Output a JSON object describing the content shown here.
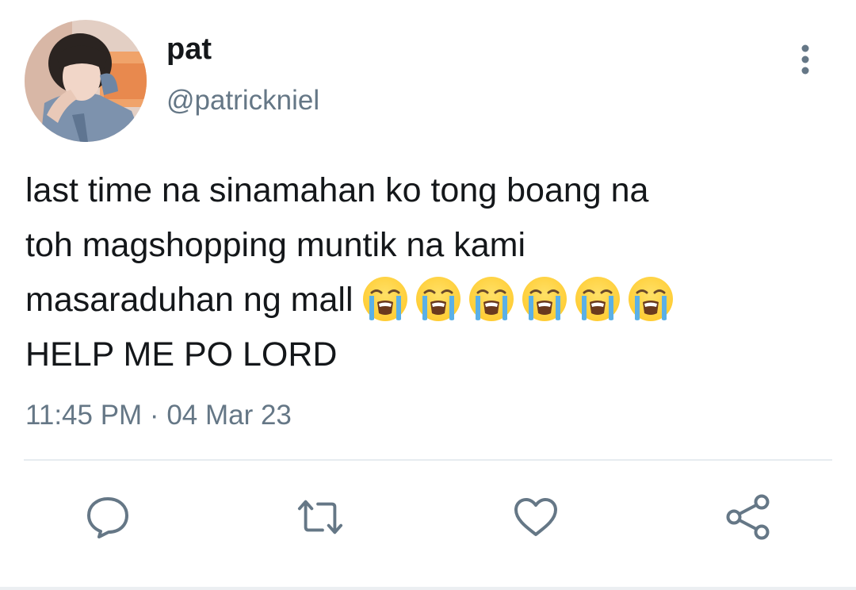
{
  "user": {
    "display_name": "pat",
    "handle": "@patrickniel"
  },
  "tweet": {
    "lines": [
      "last time na sinamahan ko tong boang na",
      "toh magshopping muntik na kami",
      "masaraduhan ng mall",
      "HELP ME PO LORD"
    ],
    "emojis": [
      "loudly-crying-face",
      "loudly-crying-face",
      "loudly-crying-face",
      "loudly-crying-face",
      "loudly-crying-face",
      "loudly-crying-face"
    ],
    "timestamp": "11:45 PM · 04 Mar 23"
  },
  "actions": [
    {
      "name": "reply",
      "icon": "comment-icon"
    },
    {
      "name": "retweet",
      "icon": "retweet-icon"
    },
    {
      "name": "like",
      "icon": "heart-icon"
    },
    {
      "name": "share",
      "icon": "share-icon"
    }
  ],
  "colors": {
    "text": "#14171a",
    "secondary": "#657786",
    "icon": "#657786",
    "divider": "#e6ecf0",
    "emoji_face": "#ffcc33",
    "emoji_tears": "#5ab0e6"
  }
}
